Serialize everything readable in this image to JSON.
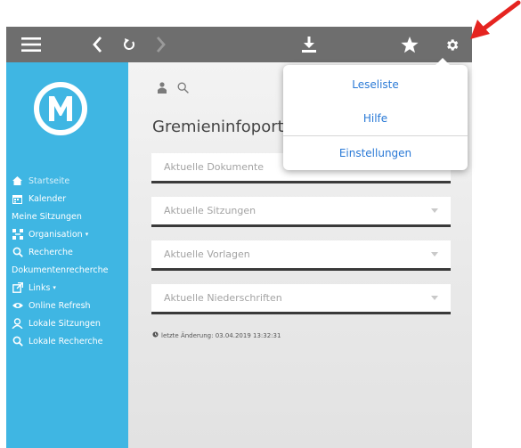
{
  "toolbar": {
    "icons": [
      "menu-icon",
      "back-icon",
      "refresh-icon",
      "forward-icon",
      "download-icon",
      "star-icon",
      "gear-icon"
    ],
    "color": "#6e6e6e"
  },
  "sidebar": {
    "color": "#3fb6e3",
    "logo_letter": "M",
    "items": [
      {
        "label": "Startseite",
        "icon": "home-icon"
      },
      {
        "label": "Kalender",
        "icon": "calendar-icon"
      },
      {
        "label": "Meine Sitzungen",
        "icon": ""
      },
      {
        "label": "Organisation",
        "icon": "organisation-icon"
      },
      {
        "label": "Recherche",
        "icon": "search-icon"
      },
      {
        "label": "Dokumentenrecherche",
        "icon": ""
      },
      {
        "label": "Links",
        "icon": "external-link-icon"
      },
      {
        "label": "Online Refresh",
        "icon": "eye-icon"
      },
      {
        "label": "Lokale Sitzungen",
        "icon": "user-group-icon"
      },
      {
        "label": "Lokale Recherche",
        "icon": "search-icon"
      }
    ]
  },
  "main": {
    "title": "Gremieninfoporta",
    "fields": [
      {
        "label": "Aktuelle Dokumente"
      },
      {
        "label": "Aktuelle Sitzungen"
      },
      {
        "label": "Aktuelle Vorlagen"
      },
      {
        "label": "Aktuelle Niederschriften"
      }
    ],
    "last_change": "letzte Änderung: 03.04.2019 13:32:31"
  },
  "dropdown": {
    "items": [
      "Leseliste",
      "Hilfe",
      "Einstellungen"
    ],
    "accent": "#2979d6"
  },
  "annotation": {
    "arrow_color": "#e52420"
  }
}
